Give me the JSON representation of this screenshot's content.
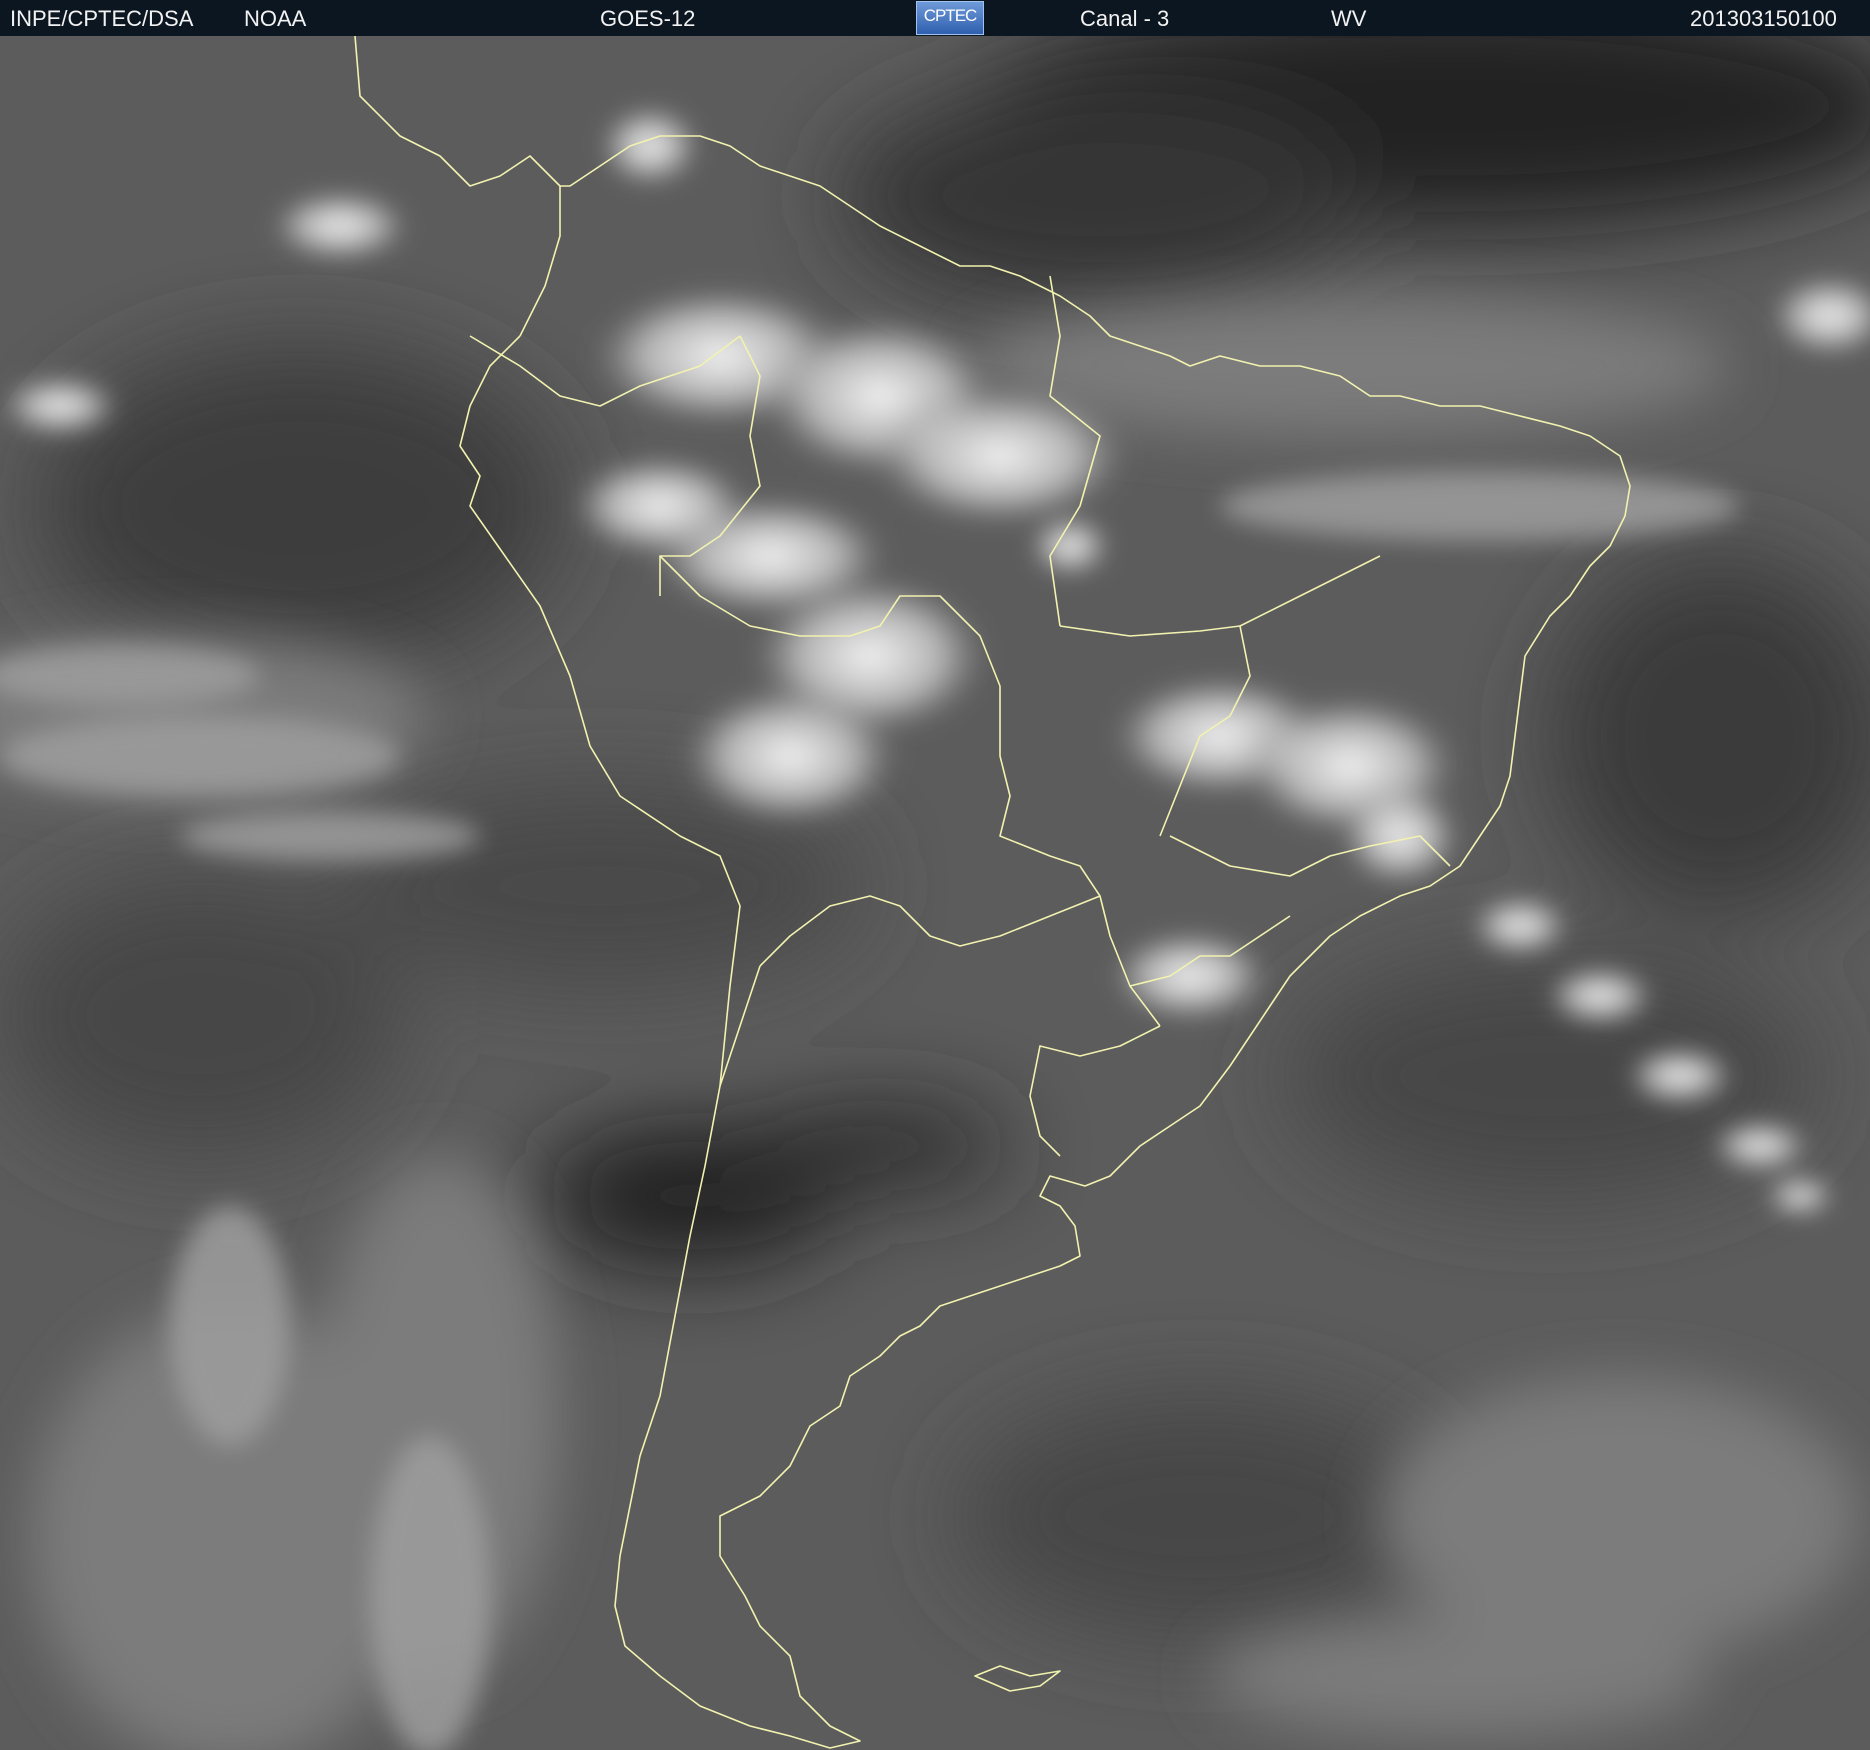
{
  "header": {
    "source": "INPE/CPTEC/DSA",
    "agency": "NOAA",
    "satellite": "GOES-12",
    "logo": "CPTEC",
    "channel": "Canal - 3",
    "band": "WV",
    "timestamp": "201303150100"
  },
  "colors": {
    "header_bg": "#0c1621",
    "coastline": "#f2f2b0",
    "ocean_vapor": "#5b5b5b",
    "dry_air": "#1a1a1a",
    "cloud": "#f4f4f4"
  }
}
